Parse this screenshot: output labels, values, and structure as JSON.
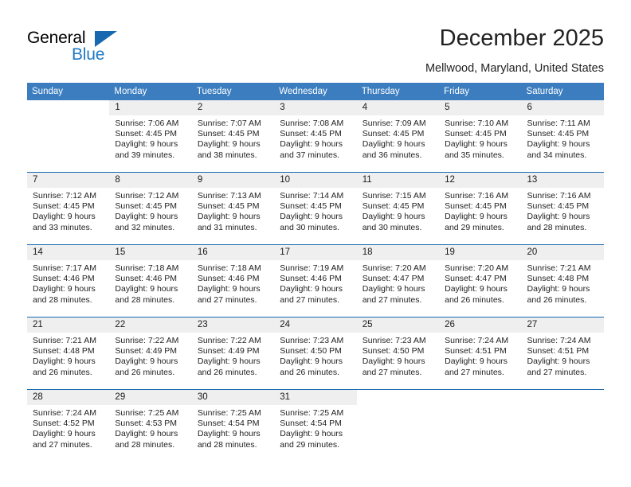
{
  "brand": {
    "name_top": "General",
    "name_bottom": "Blue"
  },
  "header": {
    "title": "December 2025",
    "subtitle": "Mellwood, Maryland, United States"
  },
  "calendar": {
    "weekday_headers": [
      "Sunday",
      "Monday",
      "Tuesday",
      "Wednesday",
      "Thursday",
      "Friday",
      "Saturday"
    ],
    "accent_color": "#3b7dbf",
    "separator_color": "#1868b0",
    "daynum_band_color": "#efefef",
    "weeks": [
      [
        {
          "day": "",
          "empty": true
        },
        {
          "day": "1",
          "sunrise": "Sunrise: 7:06 AM",
          "sunset": "Sunset: 4:45 PM",
          "daylight_line1": "Daylight: 9 hours",
          "daylight_line2": "and 39 minutes."
        },
        {
          "day": "2",
          "sunrise": "Sunrise: 7:07 AM",
          "sunset": "Sunset: 4:45 PM",
          "daylight_line1": "Daylight: 9 hours",
          "daylight_line2": "and 38 minutes."
        },
        {
          "day": "3",
          "sunrise": "Sunrise: 7:08 AM",
          "sunset": "Sunset: 4:45 PM",
          "daylight_line1": "Daylight: 9 hours",
          "daylight_line2": "and 37 minutes."
        },
        {
          "day": "4",
          "sunrise": "Sunrise: 7:09 AM",
          "sunset": "Sunset: 4:45 PM",
          "daylight_line1": "Daylight: 9 hours",
          "daylight_line2": "and 36 minutes."
        },
        {
          "day": "5",
          "sunrise": "Sunrise: 7:10 AM",
          "sunset": "Sunset: 4:45 PM",
          "daylight_line1": "Daylight: 9 hours",
          "daylight_line2": "and 35 minutes."
        },
        {
          "day": "6",
          "sunrise": "Sunrise: 7:11 AM",
          "sunset": "Sunset: 4:45 PM",
          "daylight_line1": "Daylight: 9 hours",
          "daylight_line2": "and 34 minutes."
        }
      ],
      [
        {
          "day": "7",
          "sunrise": "Sunrise: 7:12 AM",
          "sunset": "Sunset: 4:45 PM",
          "daylight_line1": "Daylight: 9 hours",
          "daylight_line2": "and 33 minutes."
        },
        {
          "day": "8",
          "sunrise": "Sunrise: 7:12 AM",
          "sunset": "Sunset: 4:45 PM",
          "daylight_line1": "Daylight: 9 hours",
          "daylight_line2": "and 32 minutes."
        },
        {
          "day": "9",
          "sunrise": "Sunrise: 7:13 AM",
          "sunset": "Sunset: 4:45 PM",
          "daylight_line1": "Daylight: 9 hours",
          "daylight_line2": "and 31 minutes."
        },
        {
          "day": "10",
          "sunrise": "Sunrise: 7:14 AM",
          "sunset": "Sunset: 4:45 PM",
          "daylight_line1": "Daylight: 9 hours",
          "daylight_line2": "and 30 minutes."
        },
        {
          "day": "11",
          "sunrise": "Sunrise: 7:15 AM",
          "sunset": "Sunset: 4:45 PM",
          "daylight_line1": "Daylight: 9 hours",
          "daylight_line2": "and 30 minutes."
        },
        {
          "day": "12",
          "sunrise": "Sunrise: 7:16 AM",
          "sunset": "Sunset: 4:45 PM",
          "daylight_line1": "Daylight: 9 hours",
          "daylight_line2": "and 29 minutes."
        },
        {
          "day": "13",
          "sunrise": "Sunrise: 7:16 AM",
          "sunset": "Sunset: 4:45 PM",
          "daylight_line1": "Daylight: 9 hours",
          "daylight_line2": "and 28 minutes."
        }
      ],
      [
        {
          "day": "14",
          "sunrise": "Sunrise: 7:17 AM",
          "sunset": "Sunset: 4:46 PM",
          "daylight_line1": "Daylight: 9 hours",
          "daylight_line2": "and 28 minutes."
        },
        {
          "day": "15",
          "sunrise": "Sunrise: 7:18 AM",
          "sunset": "Sunset: 4:46 PM",
          "daylight_line1": "Daylight: 9 hours",
          "daylight_line2": "and 28 minutes."
        },
        {
          "day": "16",
          "sunrise": "Sunrise: 7:18 AM",
          "sunset": "Sunset: 4:46 PM",
          "daylight_line1": "Daylight: 9 hours",
          "daylight_line2": "and 27 minutes."
        },
        {
          "day": "17",
          "sunrise": "Sunrise: 7:19 AM",
          "sunset": "Sunset: 4:46 PM",
          "daylight_line1": "Daylight: 9 hours",
          "daylight_line2": "and 27 minutes."
        },
        {
          "day": "18",
          "sunrise": "Sunrise: 7:20 AM",
          "sunset": "Sunset: 4:47 PM",
          "daylight_line1": "Daylight: 9 hours",
          "daylight_line2": "and 27 minutes."
        },
        {
          "day": "19",
          "sunrise": "Sunrise: 7:20 AM",
          "sunset": "Sunset: 4:47 PM",
          "daylight_line1": "Daylight: 9 hours",
          "daylight_line2": "and 26 minutes."
        },
        {
          "day": "20",
          "sunrise": "Sunrise: 7:21 AM",
          "sunset": "Sunset: 4:48 PM",
          "daylight_line1": "Daylight: 9 hours",
          "daylight_line2": "and 26 minutes."
        }
      ],
      [
        {
          "day": "21",
          "sunrise": "Sunrise: 7:21 AM",
          "sunset": "Sunset: 4:48 PM",
          "daylight_line1": "Daylight: 9 hours",
          "daylight_line2": "and 26 minutes."
        },
        {
          "day": "22",
          "sunrise": "Sunrise: 7:22 AM",
          "sunset": "Sunset: 4:49 PM",
          "daylight_line1": "Daylight: 9 hours",
          "daylight_line2": "and 26 minutes."
        },
        {
          "day": "23",
          "sunrise": "Sunrise: 7:22 AM",
          "sunset": "Sunset: 4:49 PM",
          "daylight_line1": "Daylight: 9 hours",
          "daylight_line2": "and 26 minutes."
        },
        {
          "day": "24",
          "sunrise": "Sunrise: 7:23 AM",
          "sunset": "Sunset: 4:50 PM",
          "daylight_line1": "Daylight: 9 hours",
          "daylight_line2": "and 26 minutes."
        },
        {
          "day": "25",
          "sunrise": "Sunrise: 7:23 AM",
          "sunset": "Sunset: 4:50 PM",
          "daylight_line1": "Daylight: 9 hours",
          "daylight_line2": "and 27 minutes."
        },
        {
          "day": "26",
          "sunrise": "Sunrise: 7:24 AM",
          "sunset": "Sunset: 4:51 PM",
          "daylight_line1": "Daylight: 9 hours",
          "daylight_line2": "and 27 minutes."
        },
        {
          "day": "27",
          "sunrise": "Sunrise: 7:24 AM",
          "sunset": "Sunset: 4:51 PM",
          "daylight_line1": "Daylight: 9 hours",
          "daylight_line2": "and 27 minutes."
        }
      ],
      [
        {
          "day": "28",
          "sunrise": "Sunrise: 7:24 AM",
          "sunset": "Sunset: 4:52 PM",
          "daylight_line1": "Daylight: 9 hours",
          "daylight_line2": "and 27 minutes."
        },
        {
          "day": "29",
          "sunrise": "Sunrise: 7:25 AM",
          "sunset": "Sunset: 4:53 PM",
          "daylight_line1": "Daylight: 9 hours",
          "daylight_line2": "and 28 minutes."
        },
        {
          "day": "30",
          "sunrise": "Sunrise: 7:25 AM",
          "sunset": "Sunset: 4:54 PM",
          "daylight_line1": "Daylight: 9 hours",
          "daylight_line2": "and 28 minutes."
        },
        {
          "day": "31",
          "sunrise": "Sunrise: 7:25 AM",
          "sunset": "Sunset: 4:54 PM",
          "daylight_line1": "Daylight: 9 hours",
          "daylight_line2": "and 29 minutes."
        },
        {
          "day": "",
          "empty": true
        },
        {
          "day": "",
          "empty": true
        },
        {
          "day": "",
          "empty": true
        }
      ]
    ]
  }
}
